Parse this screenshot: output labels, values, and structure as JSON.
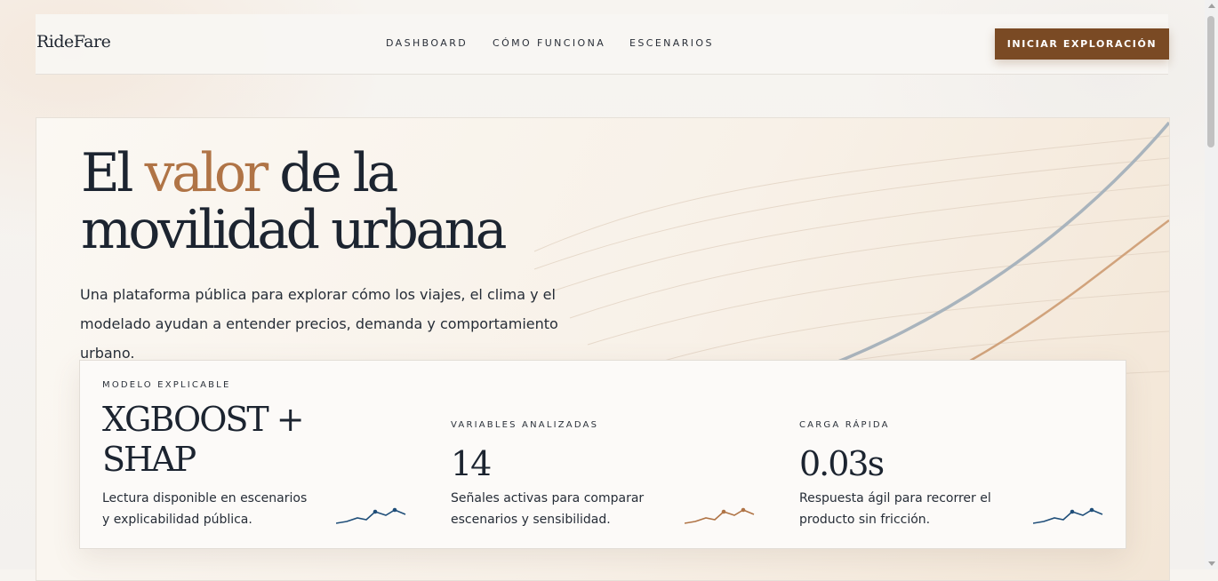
{
  "brand": "RideFare",
  "nav": [
    {
      "label": "DASHBOARD"
    },
    {
      "label": "CÓMO FUNCIONA"
    },
    {
      "label": "ESCENARIOS"
    }
  ],
  "cta_label": "INICIAR EXPLORACIÓN",
  "hero": {
    "title_part1": "El ",
    "title_accent": "valor",
    "title_part2": " de la movilidad urbana",
    "lead": "Una plataforma pública para explorar cómo los viajes, el clima y el modelado ayudan a entender precios, demanda y comportamiento urbano."
  },
  "stats": [
    {
      "label": "MODELO EXPLICABLE",
      "value": "XGBOOST + SHAP",
      "desc": "Lectura disponible en escenarios y explicabilidad pública.",
      "spark_color": "#1f4e79"
    },
    {
      "label": "VARIABLES ANALIZADAS",
      "value": "14",
      "desc": "Señales activas para comparar escenarios y sensibilidad.",
      "spark_color": "#b07446"
    },
    {
      "label": "CARGA RÁPIDA",
      "value": "0.03s",
      "desc": "Respuesta ágil para recorrer el producto sin fricción.",
      "spark_color": "#1f4e79"
    }
  ],
  "colors": {
    "accent": "#b07446",
    "cta": "#7a4a24",
    "ink": "#1c2430"
  }
}
